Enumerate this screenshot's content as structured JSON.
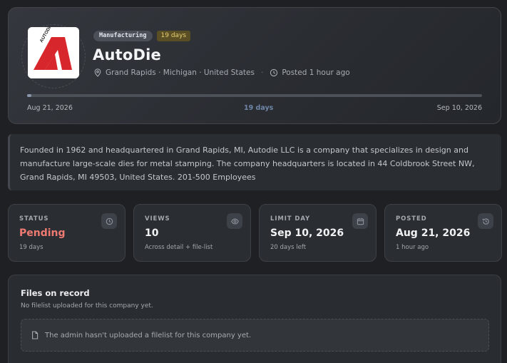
{
  "company": {
    "name": "AutoDie",
    "industry_tag": "Manufacturing",
    "days_tag": "19 days",
    "location": "Grand Rapids · Michigan · United States",
    "posted": "Posted 1 hour ago",
    "logo_text": "AUTODIE"
  },
  "timeline": {
    "start": "Aug 21, 2026",
    "middle": "19 days",
    "end": "Sep 10, 2026",
    "progress_percent": 1
  },
  "description": "Founded in 1962 and headquartered in Grand Rapids, MI, Autodie LLC is a company that specializes in design and manufacture large-scale dies for metal stamping. The company headquarters is located in 44 Coldbrook Street NW, Grand Rapids, MI 49503, United States. 201-500 Employees",
  "stats": {
    "status": {
      "label": "STATUS",
      "value": "Pending",
      "sub": "19 days",
      "icon": "clock-icon"
    },
    "views": {
      "label": "VIEWS",
      "value": "10",
      "sub": "Across detail + file-list",
      "icon": "eye-icon"
    },
    "limit": {
      "label": "LIMIT DAY",
      "value": "Sep 10, 2026",
      "sub": "20 days left",
      "icon": "calendar-icon"
    },
    "posted": {
      "label": "POSTED",
      "value": "Aug 21, 2026",
      "sub": "1 hour ago",
      "icon": "history-icon"
    }
  },
  "files": {
    "title": "Files on record",
    "subtitle": "No filelist uploaded for this company yet.",
    "empty_message": "The admin hasn't uploaded a filelist for this company yet."
  },
  "colors": {
    "background": "#1e2023",
    "pending": "#ef7a72",
    "brand_red": "#d7262c",
    "days_tag": "#e7cf72"
  }
}
